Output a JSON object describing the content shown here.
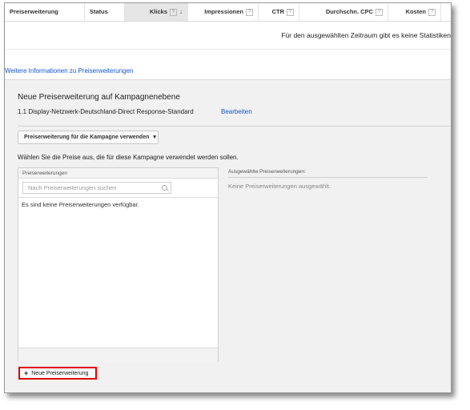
{
  "table": {
    "headers": [
      {
        "label": "Preiserweiterung"
      },
      {
        "label": "Status"
      },
      {
        "label": "Klicks",
        "help": "?",
        "sort": "↓"
      },
      {
        "label": "Impressionen",
        "help": "?"
      },
      {
        "label": "CTR",
        "help": "?"
      },
      {
        "label": "Durchschn. CPC",
        "help": "?"
      },
      {
        "label": "Kosten",
        "help": "?"
      }
    ],
    "empty_message": "Für den ausgewählten Zeitraum gibt es keine Statistiken"
  },
  "more_info_link": "Weitere Informationen zu Preiserweiterungen",
  "panel": {
    "title": "Neue Preiserweiterung auf Kampagnenebene",
    "campaign": "1.1 Display-Netzwerk-Deutschland-Direct Response-Standard",
    "edit_link": "Bearbeiten",
    "dropdown": {
      "label": "Preiserweiterung für die Kampagne verwenden",
      "caret": "▾"
    },
    "instruction": "Wählen Sie die Preise aus, die für diese Kampagne verwendet werden sollen.",
    "list": {
      "header": "Preiserweiterungen",
      "search_placeholder": "Nach Preiserweiterungen suchen",
      "empty": "Es sind keine Preiserweiterungen verfügbar."
    },
    "selected": {
      "header": "Ausgewählte Preiserweiterungen:",
      "empty": "Keine Preiserweiterungen ausgewählt."
    },
    "new_button": {
      "icon": "+",
      "label": "Neue Preiserweiterung"
    }
  },
  "colors": {
    "link": "#1155cc",
    "highlight": "#e00000",
    "panel_bg": "#f1f1f1"
  }
}
